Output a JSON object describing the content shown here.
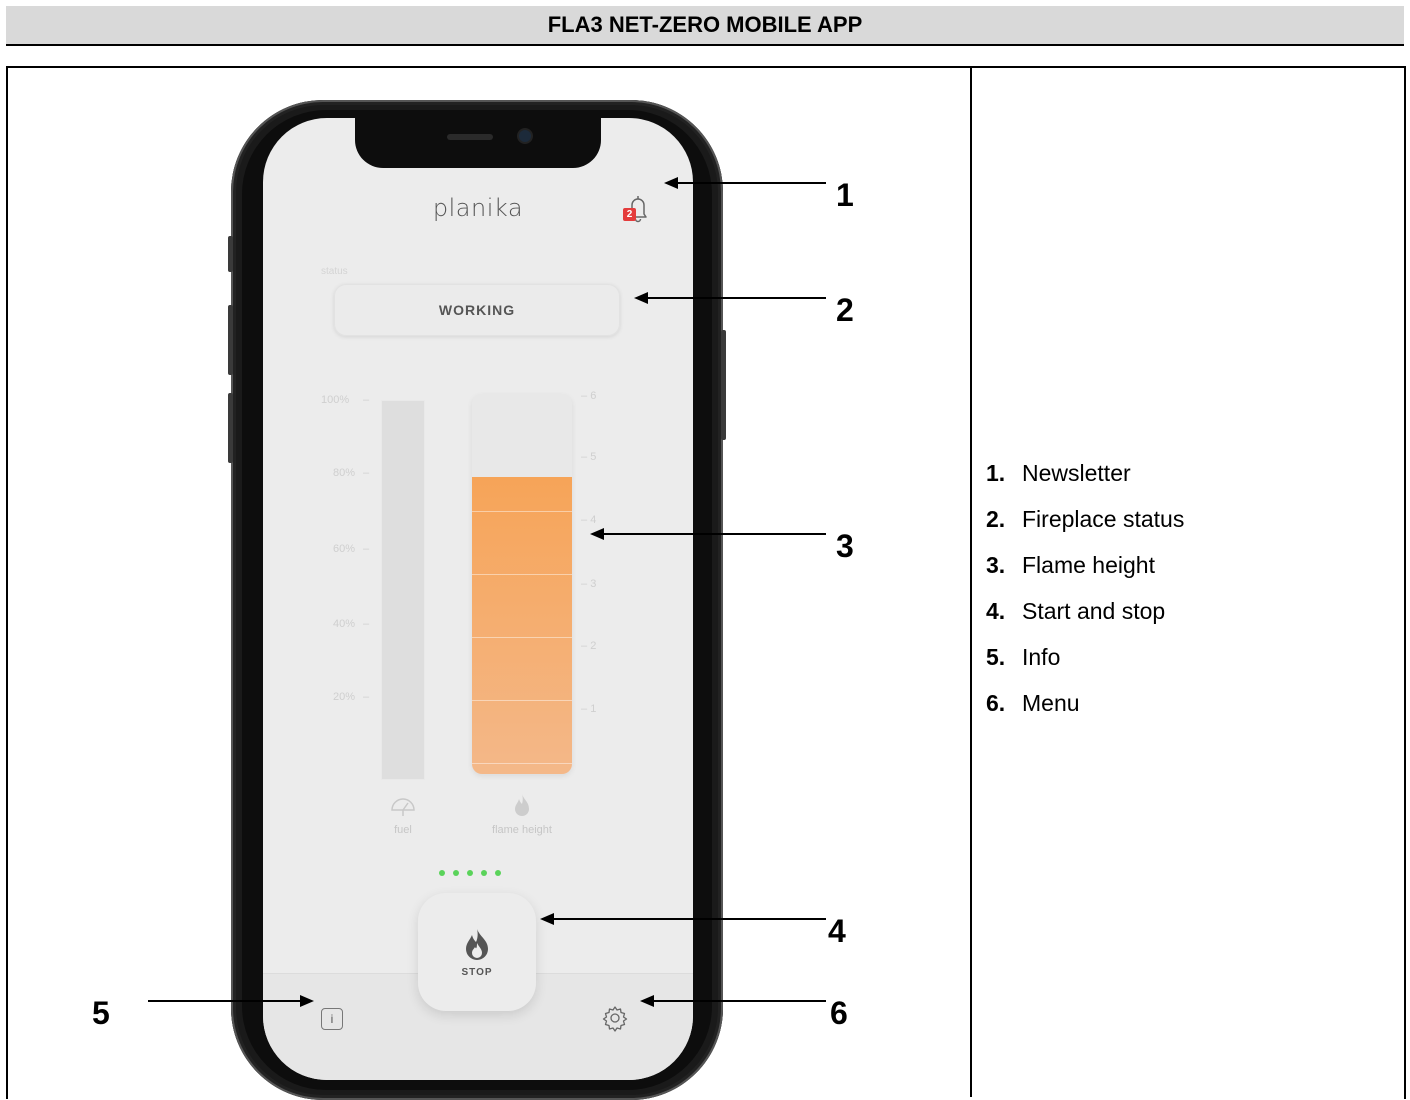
{
  "header": {
    "title": "FLA3 NET-ZERO MOBILE APP"
  },
  "app": {
    "brand": "planika",
    "notification_count": "2",
    "status_label": "status",
    "status_value": "WORKING",
    "fuel_axis": [
      "100%",
      "80%",
      "60%",
      "40%",
      "20%"
    ],
    "flame_axis": [
      "6",
      "5",
      "4",
      "3",
      "2",
      "1"
    ],
    "fuel_caption": "fuel",
    "flame_caption": "flame height",
    "flame_level": 5,
    "flame_max": 6,
    "stop_label": "STOP",
    "info_label": "i",
    "accent_orange": "#f6a458",
    "indicator_green": "#5ad35a",
    "badge_red": "#e43c3c"
  },
  "callouts": [
    "1",
    "2",
    "3",
    "4",
    "5",
    "6"
  ],
  "legend": [
    {
      "num": "1.",
      "label": "Newsletter"
    },
    {
      "num": "2.",
      "label": "Fireplace status"
    },
    {
      "num": "3.",
      "label": "Flame height"
    },
    {
      "num": "4.",
      "label": "Start and stop"
    },
    {
      "num": "5.",
      "label": "Info"
    },
    {
      "num": "6.",
      "label": "Menu"
    }
  ]
}
